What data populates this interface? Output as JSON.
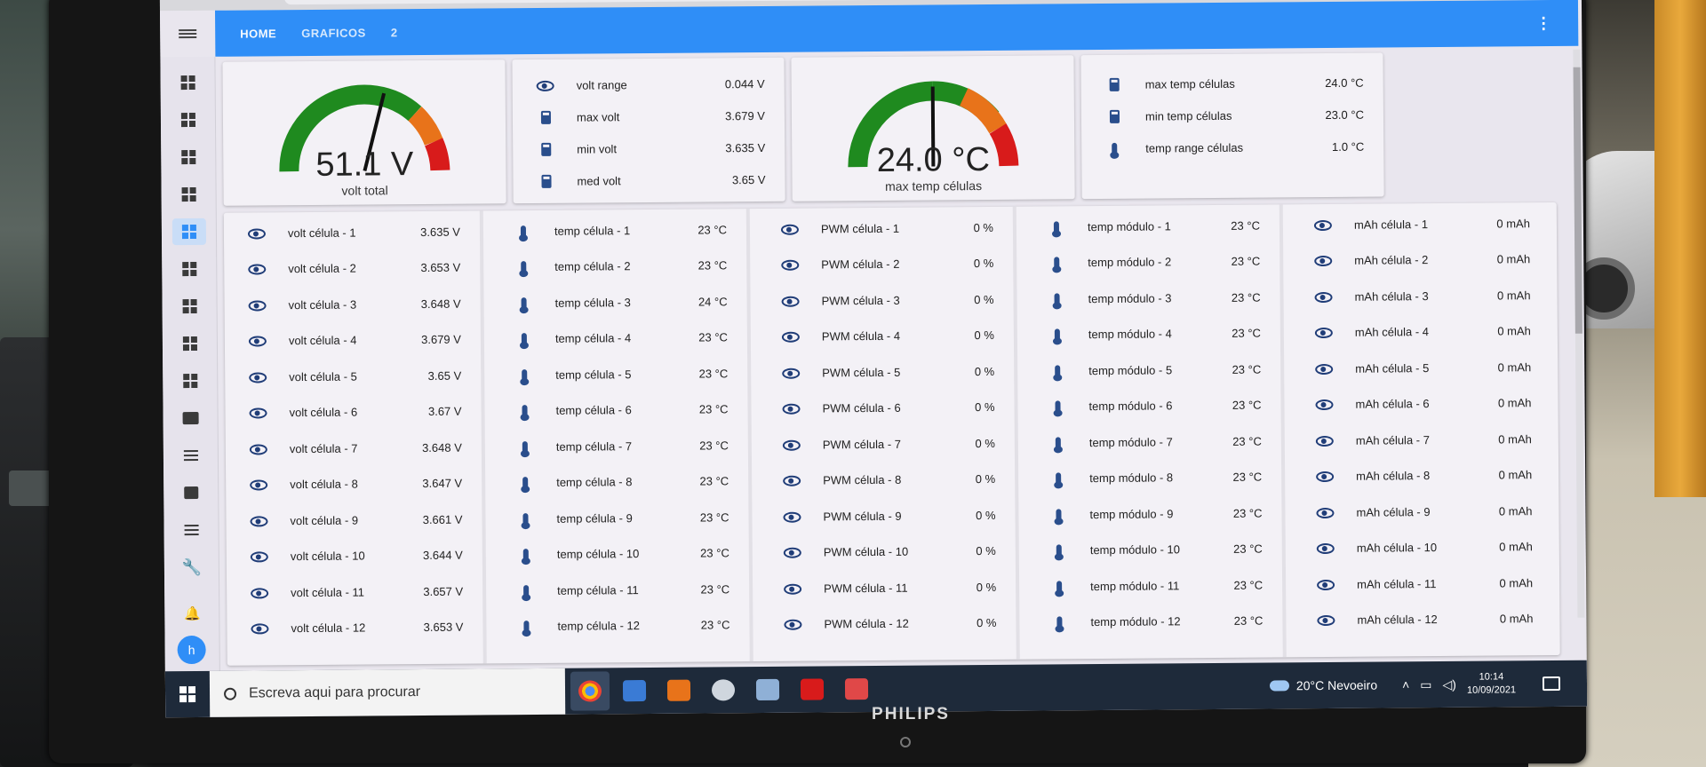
{
  "brand": "PHILIPS",
  "header": {
    "tabs": [
      "HOME",
      "GRAFICOS",
      "2"
    ],
    "more_icon": "⋮"
  },
  "avatar": "h",
  "gauges": [
    {
      "value_text": "51.1 V",
      "name": "volt total",
      "needle_fraction": 0.58
    },
    {
      "value_text": "24.0 °C",
      "name": "max temp células",
      "needle_fraction": 0.5
    }
  ],
  "volt_summary": [
    {
      "label": "volt range",
      "value": "0.044 V",
      "icon": "eye-icon"
    },
    {
      "label": "max volt",
      "value": "3.679 V",
      "icon": "calculator-icon"
    },
    {
      "label": "min volt",
      "value": "3.635 V",
      "icon": "calculator-icon"
    },
    {
      "label": "med volt",
      "value": "3.65 V",
      "icon": "calculator-icon"
    }
  ],
  "temp_summary": [
    {
      "label": "max temp células",
      "value": "24.0 °C",
      "icon": "calculator-icon"
    },
    {
      "label": "min temp células",
      "value": "23.0 °C",
      "icon": "calculator-icon"
    },
    {
      "label": "temp range células",
      "value": "1.0 °C",
      "icon": "thermometer-icon"
    }
  ],
  "volt_cells": [
    {
      "label": "volt célula - 1",
      "value": "3.635 V"
    },
    {
      "label": "volt célula - 2",
      "value": "3.653 V"
    },
    {
      "label": "volt célula - 3",
      "value": "3.648 V"
    },
    {
      "label": "volt célula - 4",
      "value": "3.679 V"
    },
    {
      "label": "volt célula - 5",
      "value": "3.65 V"
    },
    {
      "label": "volt célula - 6",
      "value": "3.67 V"
    },
    {
      "label": "volt célula - 7",
      "value": "3.648 V"
    },
    {
      "label": "volt célula - 8",
      "value": "3.647 V"
    },
    {
      "label": "volt célula - 9",
      "value": "3.661 V"
    },
    {
      "label": "volt célula - 10",
      "value": "3.644 V"
    },
    {
      "label": "volt célula - 11",
      "value": "3.657 V"
    },
    {
      "label": "volt célula - 12",
      "value": "3.653 V"
    }
  ],
  "temp_cells": [
    {
      "label": "temp célula - 1",
      "value": "23 °C"
    },
    {
      "label": "temp célula - 2",
      "value": "23 °C"
    },
    {
      "label": "temp célula - 3",
      "value": "24 °C"
    },
    {
      "label": "temp célula - 4",
      "value": "23 °C"
    },
    {
      "label": "temp célula - 5",
      "value": "23 °C"
    },
    {
      "label": "temp célula - 6",
      "value": "23 °C"
    },
    {
      "label": "temp célula - 7",
      "value": "23 °C"
    },
    {
      "label": "temp célula - 8",
      "value": "23 °C"
    },
    {
      "label": "temp célula - 9",
      "value": "23 °C"
    },
    {
      "label": "temp célula - 10",
      "value": "23 °C"
    },
    {
      "label": "temp célula - 11",
      "value": "23 °C"
    },
    {
      "label": "temp célula - 12",
      "value": "23 °C"
    }
  ],
  "pwm_cells": [
    {
      "label": "PWM célula - 1",
      "value": "0 %"
    },
    {
      "label": "PWM célula - 2",
      "value": "0 %"
    },
    {
      "label": "PWM célula - 3",
      "value": "0 %"
    },
    {
      "label": "PWM célula - 4",
      "value": "0 %"
    },
    {
      "label": "PWM célula - 5",
      "value": "0 %"
    },
    {
      "label": "PWM célula - 6",
      "value": "0 %"
    },
    {
      "label": "PWM célula - 7",
      "value": "0 %"
    },
    {
      "label": "PWM célula - 8",
      "value": "0 %"
    },
    {
      "label": "PWM célula - 9",
      "value": "0 %"
    },
    {
      "label": "PWM célula - 10",
      "value": "0 %"
    },
    {
      "label": "PWM célula - 11",
      "value": "0 %"
    },
    {
      "label": "PWM célula - 12",
      "value": "0 %"
    }
  ],
  "temp_modules": [
    {
      "label": "temp módulo - 1",
      "value": "23 °C"
    },
    {
      "label": "temp módulo - 2",
      "value": "23 °C"
    },
    {
      "label": "temp módulo - 3",
      "value": "23 °C"
    },
    {
      "label": "temp módulo - 4",
      "value": "23 °C"
    },
    {
      "label": "temp módulo - 5",
      "value": "23 °C"
    },
    {
      "label": "temp módulo - 6",
      "value": "23 °C"
    },
    {
      "label": "temp módulo - 7",
      "value": "23 °C"
    },
    {
      "label": "temp módulo - 8",
      "value": "23 °C"
    },
    {
      "label": "temp módulo - 9",
      "value": "23 °C"
    },
    {
      "label": "temp módulo - 10",
      "value": "23 °C"
    },
    {
      "label": "temp módulo - 11",
      "value": "23 °C"
    },
    {
      "label": "temp módulo - 12",
      "value": "23 °C"
    }
  ],
  "mah_cells": [
    {
      "label": "mAh célula - 1",
      "value": "0 mAh"
    },
    {
      "label": "mAh célula - 2",
      "value": "0 mAh"
    },
    {
      "label": "mAh célula - 3",
      "value": "0 mAh"
    },
    {
      "label": "mAh célula - 4",
      "value": "0 mAh"
    },
    {
      "label": "mAh célula - 5",
      "value": "0 mAh"
    },
    {
      "label": "mAh célula - 6",
      "value": "0 mAh"
    },
    {
      "label": "mAh célula - 7",
      "value": "0 mAh"
    },
    {
      "label": "mAh célula - 8",
      "value": "0 mAh"
    },
    {
      "label": "mAh célula - 9",
      "value": "0 mAh"
    },
    {
      "label": "mAh célula - 10",
      "value": "0 mAh"
    },
    {
      "label": "mAh célula - 11",
      "value": "0 mAh"
    },
    {
      "label": "mAh célula - 12",
      "value": "0 mAh"
    }
  ],
  "taskbar": {
    "search_placeholder": "Escreva aqui para procurar",
    "weather": "20°C  Nevoeiro",
    "time": "10:14",
    "date": "10/09/2021"
  },
  "colors": {
    "accent": "#2f8ef7",
    "gauge_green": "#1f8a1f",
    "gauge_orange": "#e8731a",
    "gauge_red": "#d81b1b"
  }
}
